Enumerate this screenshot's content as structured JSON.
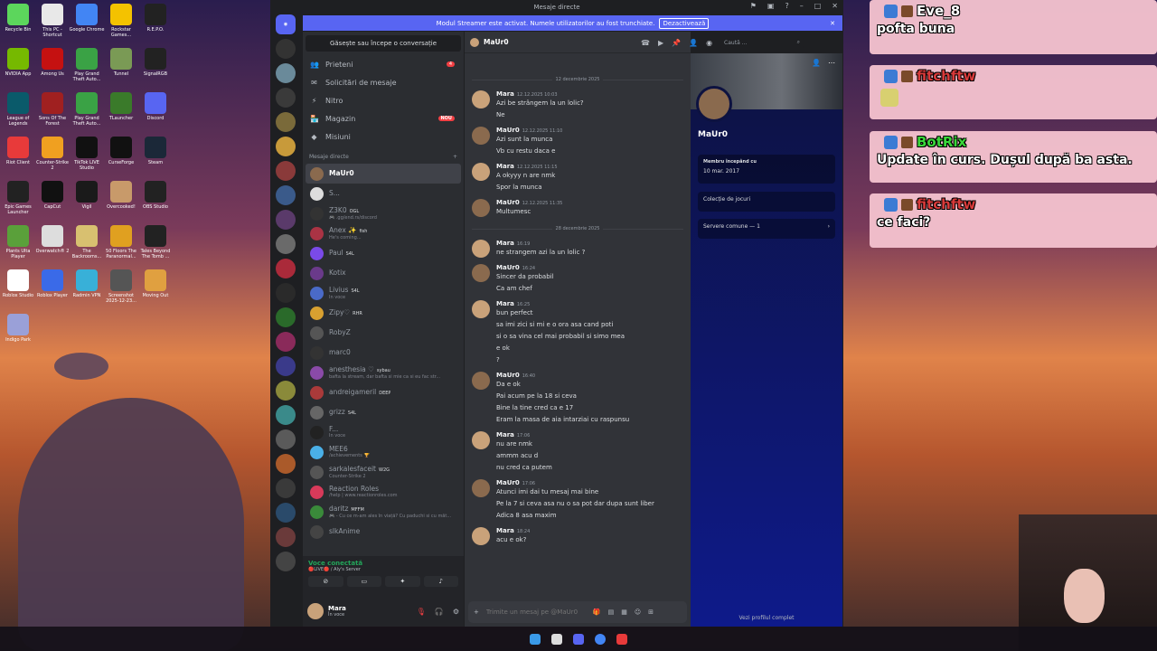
{
  "desktop_icons": [
    {
      "label": "Recycle Bin",
      "color": "#5cd65c"
    },
    {
      "label": "This PC - Shortcut",
      "color": "#e8e8e8"
    },
    {
      "label": "Google Chrome",
      "color": "#4285f4"
    },
    {
      "label": "Rockstar Games...",
      "color": "#f4c200"
    },
    {
      "label": "R.E.P.O.",
      "color": "#222"
    },
    {
      "label": "NVIDIA App",
      "color": "#76b900"
    },
    {
      "label": "Among Us",
      "color": "#c51111"
    },
    {
      "label": "Play Grand Theft Auto...",
      "color": "#3aa245"
    },
    {
      "label": "Tunnel",
      "color": "#7a9a55"
    },
    {
      "label": "SignalRGB",
      "color": "#222"
    },
    {
      "label": "League of Legends",
      "color": "#0a5a6a"
    },
    {
      "label": "Sons Of The Forest",
      "color": "#a02020"
    },
    {
      "label": "Play Grand Theft Auto...",
      "color": "#3aa245"
    },
    {
      "label": "TLauncher",
      "color": "#3a7a2a"
    },
    {
      "label": "Discord",
      "color": "#5865f2"
    },
    {
      "label": "Riot Client",
      "color": "#e83a3a"
    },
    {
      "label": "Counter-Strike 2",
      "color": "#f0a020"
    },
    {
      "label": "TikTok LIVE Studio",
      "color": "#111"
    },
    {
      "label": "CurseForge",
      "color": "#111"
    },
    {
      "label": "Steam",
      "color": "#1b2838"
    },
    {
      "label": "Epic Games Launcher",
      "color": "#222"
    },
    {
      "label": "CapCut",
      "color": "#111"
    },
    {
      "label": "Vigil",
      "color": "#1a1a1a"
    },
    {
      "label": "Overcooked!",
      "color": "#c89a6a"
    },
    {
      "label": "OBS Studio",
      "color": "#222"
    },
    {
      "label": "Plants Ulta Player",
      "color": "#5aa03a"
    },
    {
      "label": "Overwatch® 2",
      "color": "#ddd"
    },
    {
      "label": "The Backrooms...",
      "color": "#d8c070"
    },
    {
      "label": "50 Floors The Paranormal...",
      "color": "#e0a020"
    },
    {
      "label": "Tales Beyond The Tomb ...",
      "color": "#222"
    },
    {
      "label": "Roblox Studio",
      "color": "#fff"
    },
    {
      "label": "Roblox Player",
      "color": "#3a6ae8"
    },
    {
      "label": "Radmin VPN",
      "color": "#38b0d8"
    },
    {
      "label": "Screenshot 2025-12-23...",
      "color": "#555"
    },
    {
      "label": "Moving Out",
      "color": "#e0a040"
    },
    {
      "label": "Indigo Park",
      "color": "#9aa0d8"
    }
  ],
  "window": {
    "title": "Mesaje directe",
    "banner_text": "Modul Streamer este activat. Numele utilizatorilor au fost trunchiate.",
    "banner_button": "Dezactivează"
  },
  "sidebar": {
    "search": "Găsește sau începe o conversație",
    "nav": [
      {
        "label": "Prieteni",
        "icon": "👥",
        "count": "4"
      },
      {
        "label": "Solicitări de mesaje",
        "icon": "✉",
        "count": ""
      },
      {
        "label": "Nitro",
        "icon": "⚡",
        "count": ""
      },
      {
        "label": "Magazin",
        "icon": "🏪",
        "badge": "NOU"
      },
      {
        "label": "Misiuni",
        "icon": "◆",
        "count": ""
      }
    ],
    "dm_header": "Mesaje directe",
    "dms": [
      {
        "name": "MaUr0",
        "status": "",
        "tag": "",
        "color": "#8a6a4e",
        "active": true
      },
      {
        "name": "S...",
        "status": "",
        "tag": "",
        "color": "#dddddd"
      },
      {
        "name": "Z3K0",
        "status": "🎮 .gg/end.rs/discord",
        "tag": "OGL",
        "color": "#333333"
      },
      {
        "name": "Anex ✨",
        "status": "He's coming...",
        "tag": "fish",
        "color": "#aa3344"
      },
      {
        "name": "Paul",
        "status": "",
        "tag": "S4L",
        "color": "#7a4ae8"
      },
      {
        "name": "Kotix",
        "status": "",
        "tag": "",
        "color": "#6a3a8a"
      },
      {
        "name": "Livius",
        "status": "În voce",
        "tag": "S4L",
        "color": "#4a6ac8"
      },
      {
        "name": "Zipy♡",
        "status": "",
        "tag": "RHR",
        "color": "#d8a030"
      },
      {
        "name": "RobyZ",
        "status": "",
        "tag": "",
        "color": "#555555"
      },
      {
        "name": "marc0",
        "status": "",
        "tag": "",
        "color": "#333333"
      },
      {
        "name": "anesthesia ♡",
        "status": "bafta la stream, dar bafta si mie ca si eu fac str...",
        "tag": "sybau",
        "color": "#8a4aa8"
      },
      {
        "name": "andreigameril",
        "status": "",
        "tag": "DEEP",
        "color": "#aa3a3a"
      },
      {
        "name": "grizz",
        "status": "",
        "tag": "S4L",
        "color": "#666666"
      },
      {
        "name": "F...",
        "status": "În voce",
        "tag": "",
        "color": "#222222"
      },
      {
        "name": "MEE6",
        "status": "/achievements 🏆",
        "tag": "",
        "color": "#4ab0e8"
      },
      {
        "name": "sarkalesfaceit",
        "status": "Counter-Strike 2",
        "tag": "W2G",
        "color": "#555555"
      },
      {
        "name": "Reaction Roles",
        "status": "/help | www.reactionroles.com",
        "tag": "",
        "color": "#d83a5a"
      },
      {
        "name": "daritz",
        "status": "🎮 - Cu ce m-am ales în viață? Cu paduchi si cu mât...",
        "tag": "MFFM",
        "color": "#3a8a3a"
      },
      {
        "name": "slkAnime",
        "status": "",
        "tag": "",
        "color": "#444444"
      }
    ],
    "voice": {
      "title": "Voce conectată",
      "server": "🔴LIVE🔴 / Aly's Server"
    },
    "user": {
      "name": "Mara",
      "status": "În voce"
    }
  },
  "chat": {
    "header_name": "MaUr0",
    "search_placeholder": "Caută ...",
    "composer_placeholder": "Trimite un mesaj pe @MaUr0",
    "groups": [
      {
        "type": "divider",
        "text": "12 decembrie 2025"
      },
      {
        "type": "msg",
        "author": "Mara",
        "time": "12.12.2025 10:03",
        "color": "#c9a27a",
        "lines": [
          "Azi be strângem la un lolic?",
          "Ne"
        ]
      },
      {
        "type": "msg",
        "author": "MaUr0",
        "time": "12.12.2025 11:10",
        "color": "#8a6a4e",
        "lines": [
          "Azi sunt la munca",
          "Vb cu restu daca e"
        ]
      },
      {
        "type": "msg",
        "author": "Mara",
        "time": "12.12.2025 11:15",
        "color": "#c9a27a",
        "lines": [
          "A okyyy n are nmk",
          "Spor la munca"
        ]
      },
      {
        "type": "msg",
        "author": "MaUr0",
        "time": "12.12.2025 11:35",
        "color": "#8a6a4e",
        "lines": [
          "Multumesc"
        ]
      },
      {
        "type": "divider",
        "text": "28 decembrie 2025"
      },
      {
        "type": "msg",
        "author": "Mara",
        "time": "16:19",
        "color": "#c9a27a",
        "lines": [
          "ne strangem azi la un lolic ?"
        ]
      },
      {
        "type": "msg",
        "author": "MaUr0",
        "time": "16:24",
        "color": "#8a6a4e",
        "lines": [
          "Sincer da probabil",
          "Ca am chef"
        ]
      },
      {
        "type": "msg",
        "author": "Mara",
        "time": "16:25",
        "color": "#c9a27a",
        "lines": [
          "bun perfect",
          "sa imi zici si mi e o ora asa cand poti",
          "si o sa vina cel mai probabil si simo mea",
          "e ok",
          "?"
        ]
      },
      {
        "type": "msg",
        "author": "MaUr0",
        "time": "16:40",
        "color": "#8a6a4e",
        "lines": [
          "Da e ok",
          "Pai acum pe la 18 si ceva",
          "Bine la tine cred ca e 17",
          "Eram la masa de aia intarziai cu raspunsu"
        ]
      },
      {
        "type": "msg",
        "author": "Mara",
        "time": "17:06",
        "color": "#c9a27a",
        "lines": [
          "nu are nmk",
          "ammm acu d",
          "nu cred ca putem"
        ]
      },
      {
        "type": "msg",
        "author": "MaUr0",
        "time": "17:06",
        "color": "#8a6a4e",
        "lines": [
          "Atunci imi dai tu mesaj mai bine",
          "Pe la 7 si ceva asa nu o sa pot dar dupa sunt liber",
          "Adica 8 asa maxim"
        ]
      },
      {
        "type": "msg",
        "author": "Mara",
        "time": "18:24",
        "color": "#c9a27a",
        "lines": [
          "acu e ok?"
        ]
      }
    ]
  },
  "profile": {
    "name": "MaUr0",
    "member_since_label": "Membru începând cu",
    "member_since": "10 mar. 2017",
    "games": "Colecție de jocuri",
    "servers": "Servere comune — 1",
    "full_profile": "Vezi profilul complet"
  },
  "stream_chat": [
    {
      "user": "Eve_8",
      "text": "pofta buna",
      "user_color": "#ffffff"
    },
    {
      "user": "fitchftw",
      "text": "",
      "user_color": "#d83a3a",
      "emote": true
    },
    {
      "user": "BotRix",
      "text": "Update în curs. Dușul după ba asta.",
      "user_color": "#3ad83a"
    },
    {
      "user": "fitchftw",
      "text": "ce faci?",
      "user_color": "#d83a3a"
    }
  ]
}
